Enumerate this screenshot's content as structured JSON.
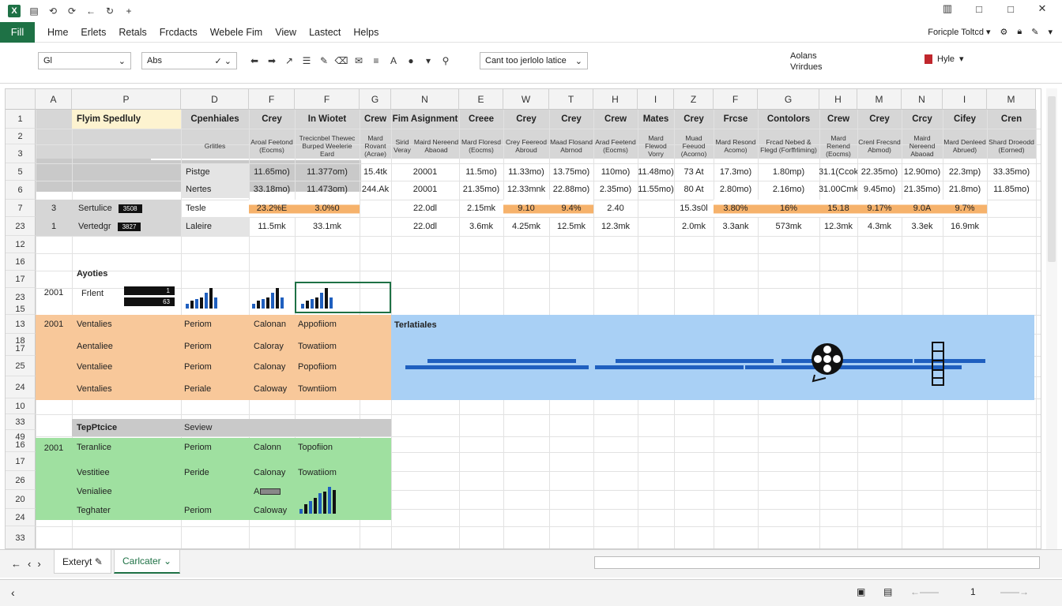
{
  "app": {
    "quick_access": [
      "save",
      "undo",
      "redo",
      "more"
    ]
  },
  "window_controls": [
    "panes",
    "restore",
    "maximize",
    "close"
  ],
  "menu": {
    "file": "Fill",
    "items": [
      "Hme",
      "Erlets",
      "Retals",
      "Frcdacts",
      "Webele Fim",
      "View",
      "Lastect",
      "Helps"
    ],
    "right_label": "Foricple Toltcd ▾"
  },
  "toolbar": {
    "namebox": "Gl",
    "font": "Abs",
    "conditional": "Cant too jerlolo latice",
    "right_line1": "Aolans",
    "right_line2": "Vrirdues",
    "style": "Hyle"
  },
  "columns": [
    "A",
    "P",
    "D",
    "F",
    "F",
    "G",
    "N",
    "E",
    "W",
    "T",
    "H",
    "I",
    "Z",
    "F",
    "G",
    "H",
    "M",
    "N",
    "I",
    "M"
  ],
  "rows": [
    "1",
    "2",
    "3",
    "5",
    "6",
    "7",
    "23",
    "12",
    "16",
    "17",
    "23",
    "15",
    "13",
    "18\n17",
    "25",
    "24",
    "10",
    "33",
    "49\n16",
    "17",
    "26",
    "20",
    "24",
    "33"
  ],
  "header_row": {
    "title": "Flyim Spedluly",
    "d": "Cpenhiales",
    "f1": "Crey",
    "f2": "In Wiotet",
    "g": "Crew",
    "n": "Fim Asignment",
    "e": "Creee",
    "w": "Crey",
    "t": "Crey",
    "h": "Crew",
    "i": "Mates",
    "z": "Crey",
    "f3": "Frcse",
    "g2": "Contolors",
    "h2": "Crew",
    "m": "Crey",
    "n2": "Crcy",
    "i2": "Cifey",
    "m2": "Cren"
  },
  "sub_header": {
    "d": "Grlitles",
    "f1": "Aroal Feetond (Eocms)",
    "f2": "Trecicnbel Thewec Burped Weelerie Eard",
    "g": "Mard Rovant (Acrae)",
    "n1": "Sirid Veray",
    "n2": "Maird Nereend Abaoad",
    "e": "Mard Floresd (Eocms)",
    "w": "Crey Feereod Abroud",
    "t": "Maad Flosand Abrnod",
    "h": "Arad Feetend (Eocms)",
    "i": "Mard Flewod Vorry",
    "z": "Muad Feeuod (Acorno)",
    "f3": "Mard Resond Acomo)",
    "g2": "Frcad Nebed & Flegd (Forffrliming)",
    "h2": "Mard Renend (Eocms)",
    "m": "Crenl Frecsnd Abmod)",
    "i2": "Mard Denleed Abrued)",
    "m2": "Shard Droeodd (Eorned)"
  },
  "row5": {
    "label": "Pistge",
    "values": [
      "11.65mo)",
      "11.377om)",
      "15.4tk",
      "20001",
      "11.5mo)",
      "11.33mo)",
      "13.75mo)",
      "110mo)",
      "11.48mo)",
      "73 At",
      "17.3mo)",
      "1.80mp)",
      "31.1(Ccok",
      "22.35mo)",
      "12.90mo)",
      "22.3mp)",
      "33.35mo)"
    ]
  },
  "row6": {
    "label": "Nertes",
    "values": [
      "33.18mo)",
      "11.473om)",
      "244.Ak",
      "20001",
      "21.35mo)",
      "12.33mnk",
      "22.88mo)",
      "2.35mo)",
      "11.55mo)",
      "80 At",
      "2.80mo)",
      "2.16mo)",
      "31.00Cmk",
      "9.45mo)",
      "21.35mo)",
      "21.8mo)",
      "11.85mo)"
    ]
  },
  "row7": {
    "a": "3",
    "p": "Sertulice",
    "p_badge": "3508",
    "d": "Tesle",
    "f1": "23.2%E",
    "f2": "3.0%0",
    "n": "22.0dl",
    "e": "2.15mk",
    "w": "9.10",
    "t": "9.4%",
    "h": "2.40",
    "z": "15.3s0l",
    "f3": "3.80%",
    "g2": "16%",
    "h2": "15.18",
    "m": "9.17%",
    "n2": "9.0A",
    "i2": "9.7%"
  },
  "row23": {
    "a": "1",
    "p": "Vertedgr",
    "p_badge": "3827",
    "d": "Laleire",
    "values": [
      "11.5mk",
      "33.1mk",
      "22.0dl",
      "3.6mk",
      "4.25mk",
      "12.5mk",
      "12.3mk",
      "2.0mk",
      "3.3ank",
      "573mk",
      "12.3mk",
      "4.3mk",
      "3.3ek",
      "16.9mk"
    ]
  },
  "ayoties": {
    "title": "Ayoties",
    "year": "2001",
    "label": "Frlent",
    "badge1": "1",
    "badge2": "63",
    "bars": [
      6,
      10,
      12,
      14,
      20,
      26,
      14
    ]
  },
  "orange_block": {
    "year": "2001",
    "rows": [
      {
        "p": "Ventalies",
        "d": "Periom",
        "f1": "Calonan",
        "f2": "Appofiiom"
      },
      {
        "p": "Aentaliee",
        "d": "Periom",
        "f1": "Caloray",
        "f2": "Towatiiom"
      },
      {
        "p": "Ventaliee",
        "d": "Periom",
        "f1": "Calonay",
        "f2": "Popofiiom"
      },
      {
        "p": "Ventalies",
        "d": "Periale",
        "f1": "Caloway",
        "f2": "Towntiiom"
      }
    ]
  },
  "blue_block": {
    "title": "Terlatiales"
  },
  "green_block": {
    "header_p": "TepPtcice",
    "header_d": "Seview",
    "year": "2001",
    "rows": [
      {
        "p": "Teranlice",
        "d": "Periom",
        "f1": "Calonn",
        "f2": "Topofiion"
      },
      {
        "p": "Vestitiee",
        "d": "Peride",
        "f1": "Calonay",
        "f2": "Towatiiom"
      },
      {
        "p": "Venialiee",
        "d": "",
        "f1": "A",
        "f2": ""
      },
      {
        "p": "Teghater",
        "d": "Periom",
        "f1": "Caloway",
        "f2": ""
      }
    ]
  },
  "sheets": {
    "tab1": "Exteryt",
    "tab2": "Carlcater"
  },
  "status": {
    "page": "1"
  },
  "colors": {
    "excel_green": "#1e7145",
    "orange": "#f8c89a",
    "blue": "#a9d0f5",
    "green": "#9fe0a0",
    "bar_blue": "#1f5fbf",
    "bar_black": "#111111"
  }
}
